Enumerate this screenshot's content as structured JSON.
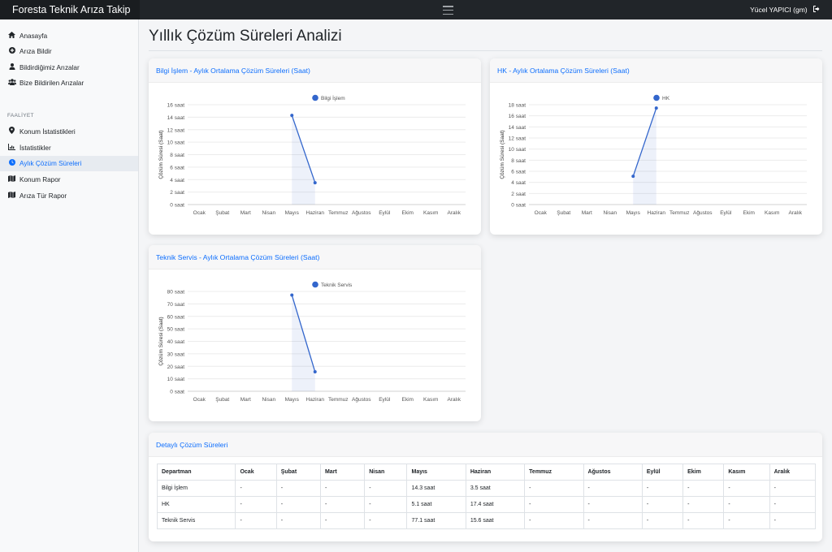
{
  "app": {
    "title": "Foresta Teknik Arıza Takip"
  },
  "user": {
    "name": "Yücel YAPICI (gm)"
  },
  "sidebar": {
    "items": [
      {
        "label": "Anasayfa",
        "icon": "home-icon"
      },
      {
        "label": "Arıza Bildir",
        "icon": "plus-circle-icon"
      },
      {
        "label": "Bildirdiğimiz Arızalar",
        "icon": "user-icon"
      },
      {
        "label": "Bize Bildirilen Arızalar",
        "icon": "users-icon"
      }
    ],
    "section_label": "FAALİYET",
    "section_items": [
      {
        "label": "Konum İstatistikleri",
        "icon": "map-pin-icon"
      },
      {
        "label": "İstatistikler",
        "icon": "chart-icon"
      },
      {
        "label": "Aylık Çözüm Süreleri",
        "icon": "clock-icon",
        "active": true
      },
      {
        "label": "Konum Rapor",
        "icon": "map-icon"
      },
      {
        "label": "Arıza Tür Rapor",
        "icon": "map-icon"
      }
    ]
  },
  "page": {
    "title": "Yıllık Çözüm Süreleri Analizi"
  },
  "charts": [
    {
      "title": "Bilgi İşlem - Aylık Ortalama Çözüm Süreleri (Saat)"
    },
    {
      "title": "HK - Aylık Ortalama Çözüm Süreleri (Saat)"
    },
    {
      "title": "Teknik Servis - Aylık Ortalama Çözüm Süreleri (Saat)"
    }
  ],
  "chart_data": [
    {
      "type": "line",
      "title": "Bilgi İşlem - Aylık Ortalama Çözüm Süreleri (Saat)",
      "categories": [
        "Ocak",
        "Şubat",
        "Mart",
        "Nisan",
        "Mayıs",
        "Haziran",
        "Temmuz",
        "Ağustos",
        "Eylül",
        "Ekim",
        "Kasım",
        "Aralık"
      ],
      "series": [
        {
          "name": "Bilgi İşlem",
          "values": [
            null,
            null,
            null,
            null,
            14.3,
            3.5,
            null,
            null,
            null,
            null,
            null,
            null
          ]
        }
      ],
      "ylabel": "Çözüm Süresi (Saat)",
      "yticks": [
        0,
        2,
        4,
        6,
        8,
        10,
        12,
        14,
        16
      ],
      "ylim": [
        0,
        16
      ],
      "unit": "saat",
      "grid": true,
      "legend": "top",
      "color": "#3366cc"
    },
    {
      "type": "line",
      "title": "HK - Aylık Ortalama Çözüm Süreleri (Saat)",
      "categories": [
        "Ocak",
        "Şubat",
        "Mart",
        "Nisan",
        "Mayıs",
        "Haziran",
        "Temmuz",
        "Ağustos",
        "Eylül",
        "Ekim",
        "Kasım",
        "Aralık"
      ],
      "series": [
        {
          "name": "HK",
          "values": [
            null,
            null,
            null,
            null,
            5.1,
            17.4,
            null,
            null,
            null,
            null,
            null,
            null
          ]
        }
      ],
      "ylabel": "Çözüm Süresi (Saat)",
      "yticks": [
        0,
        2,
        4,
        6,
        8,
        10,
        12,
        14,
        16,
        18
      ],
      "ylim": [
        0,
        18
      ],
      "unit": "saat",
      "grid": true,
      "legend": "top",
      "color": "#3366cc"
    },
    {
      "type": "line",
      "title": "Teknik Servis - Aylık Ortalama Çözüm Süreleri (Saat)",
      "categories": [
        "Ocak",
        "Şubat",
        "Mart",
        "Nisan",
        "Mayıs",
        "Haziran",
        "Temmuz",
        "Ağustos",
        "Eylül",
        "Ekim",
        "Kasım",
        "Aralık"
      ],
      "series": [
        {
          "name": "Teknik Servis",
          "values": [
            null,
            null,
            null,
            null,
            77.1,
            15.6,
            null,
            null,
            null,
            null,
            null,
            null
          ]
        }
      ],
      "ylabel": "Çözüm Süresi (Saat)",
      "yticks": [
        0,
        10,
        20,
        30,
        40,
        50,
        60,
        70,
        80
      ],
      "ylim": [
        0,
        80
      ],
      "unit": "saat",
      "grid": true,
      "legend": "top",
      "color": "#3366cc"
    }
  ],
  "table": {
    "title": "Detaylı Çözüm Süreleri",
    "headers": [
      "Departman",
      "Ocak",
      "Şubat",
      "Mart",
      "Nisan",
      "Mayıs",
      "Haziran",
      "Temmuz",
      "Ağustos",
      "Eylül",
      "Ekim",
      "Kasım",
      "Aralık"
    ],
    "rows": [
      [
        "Bilgi İşlem",
        "-",
        "-",
        "-",
        "-",
        "14.3 saat",
        "3.5 saat",
        "-",
        "-",
        "-",
        "-",
        "-",
        "-"
      ],
      [
        "HK",
        "-",
        "-",
        "-",
        "-",
        "5.1 saat",
        "17.4 saat",
        "-",
        "-",
        "-",
        "-",
        "-",
        "-"
      ],
      [
        "Teknik Servis",
        "-",
        "-",
        "-",
        "-",
        "77.1 saat",
        "15.6 saat",
        "-",
        "-",
        "-",
        "-",
        "-",
        "-"
      ]
    ]
  },
  "colors": {
    "accent": "#0d6efd",
    "series": "#3366cc",
    "topbar": "#212529"
  }
}
